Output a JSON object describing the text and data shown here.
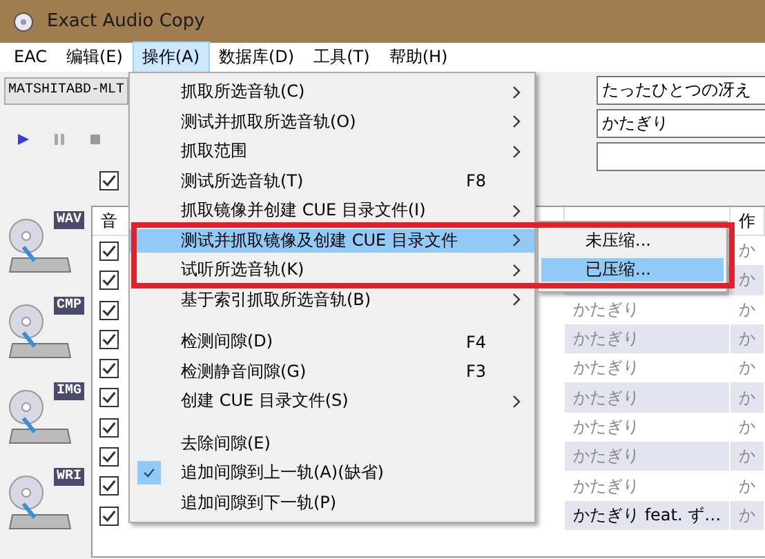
{
  "window": {
    "title": "Exact Audio Copy"
  },
  "menubar": [
    {
      "label": "EAC",
      "selected": false
    },
    {
      "label": "编辑(E)",
      "selected": false
    },
    {
      "label": "操作(A)",
      "selected": true
    },
    {
      "label": "数据库(D)",
      "selected": false
    },
    {
      "label": "工具(T)",
      "selected": false
    },
    {
      "label": "帮助(H)",
      "selected": false
    }
  ],
  "drive": {
    "value": "MATSHITABD-MLT"
  },
  "cd_fields": [
    {
      "value": "たったひとつの冴え"
    },
    {
      "value": "かたぎり"
    }
  ],
  "select_all": {
    "checked": true
  },
  "sidebar_buttons": [
    {
      "label": "WAV"
    },
    {
      "label": "CMP"
    },
    {
      "label": "IMG"
    },
    {
      "label": "WRI"
    }
  ],
  "table": {
    "columns": [
      {
        "label": "音"
      },
      {
        "label": "作"
      }
    ],
    "rows": [
      {
        "checked": true,
        "composer": "か"
      },
      {
        "checked": true,
        "composer": "か"
      },
      {
        "checked": true,
        "artist": "かたぎり",
        "dimmed": true,
        "composer": "か"
      },
      {
        "checked": true,
        "artist": "かたぎり",
        "dimmed": true,
        "composer": "か"
      },
      {
        "checked": true,
        "artist": "かたぎり",
        "dimmed": true,
        "composer": "か"
      },
      {
        "checked": true,
        "artist": "かたぎり",
        "dimmed": true,
        "composer": "か"
      },
      {
        "checked": true,
        "artist": "かたぎり",
        "dimmed": true,
        "composer": "か"
      },
      {
        "checked": true,
        "artist": "かたぎり",
        "dimmed": true,
        "composer": "か"
      },
      {
        "checked": true,
        "artist": "かたぎり",
        "dimmed": true,
        "composer": "か"
      },
      {
        "checked": true,
        "artist": "かたぎり feat. ず…",
        "dimmed": false,
        "composer": "か"
      }
    ]
  },
  "action_menu": {
    "items": [
      {
        "kind": "item",
        "label": "抓取所选音轨(C)",
        "submenu": true,
        "selected": false,
        "checked": false
      },
      {
        "kind": "item",
        "label": "测试并抓取所选音轨(O)",
        "submenu": true,
        "selected": false,
        "checked": false
      },
      {
        "kind": "item",
        "label": "抓取范围",
        "submenu": true,
        "selected": false,
        "checked": false
      },
      {
        "kind": "item",
        "label": "测试所选音轨(T)",
        "shortcut": "F8",
        "submenu": false,
        "selected": false,
        "checked": false
      },
      {
        "kind": "item",
        "label": "抓取镜像并创建 CUE 目录文件(I)",
        "submenu": true,
        "selected": false,
        "checked": false
      },
      {
        "kind": "item",
        "label": "测试并抓取镜像及创建 CUE 目录文件",
        "submenu": true,
        "selected": true,
        "checked": false
      },
      {
        "kind": "item",
        "label": "试听所选音轨(K)",
        "submenu": true,
        "selected": false,
        "checked": false
      },
      {
        "kind": "item",
        "label": "基于索引抓取所选音轨(B)",
        "submenu": true,
        "selected": false,
        "checked": false
      },
      {
        "kind": "separator"
      },
      {
        "kind": "item",
        "label": "检测间隙(D)",
        "shortcut": "F4",
        "submenu": false,
        "selected": false,
        "checked": false
      },
      {
        "kind": "item",
        "label": "检测静音间隙(G)",
        "shortcut": "F3",
        "submenu": false,
        "selected": false,
        "checked": false
      },
      {
        "kind": "item",
        "label": "创建 CUE 目录文件(S)",
        "submenu": true,
        "selected": false,
        "checked": false
      },
      {
        "kind": "separator"
      },
      {
        "kind": "item",
        "label": "去除间隙(E)",
        "submenu": false,
        "selected": false,
        "checked": false
      },
      {
        "kind": "item",
        "label": "追加间隙到上一轨(A)(缺省)",
        "submenu": false,
        "selected": false,
        "checked": true
      },
      {
        "kind": "item",
        "label": "追加间隙到下一轨(P)",
        "submenu": false,
        "selected": false,
        "checked": false
      }
    ]
  },
  "submenu": {
    "items": [
      {
        "label": "未压缩...",
        "selected": false
      },
      {
        "label": "已压缩...",
        "selected": true
      }
    ]
  },
  "annotation": {
    "kind": "highlight_frame"
  }
}
